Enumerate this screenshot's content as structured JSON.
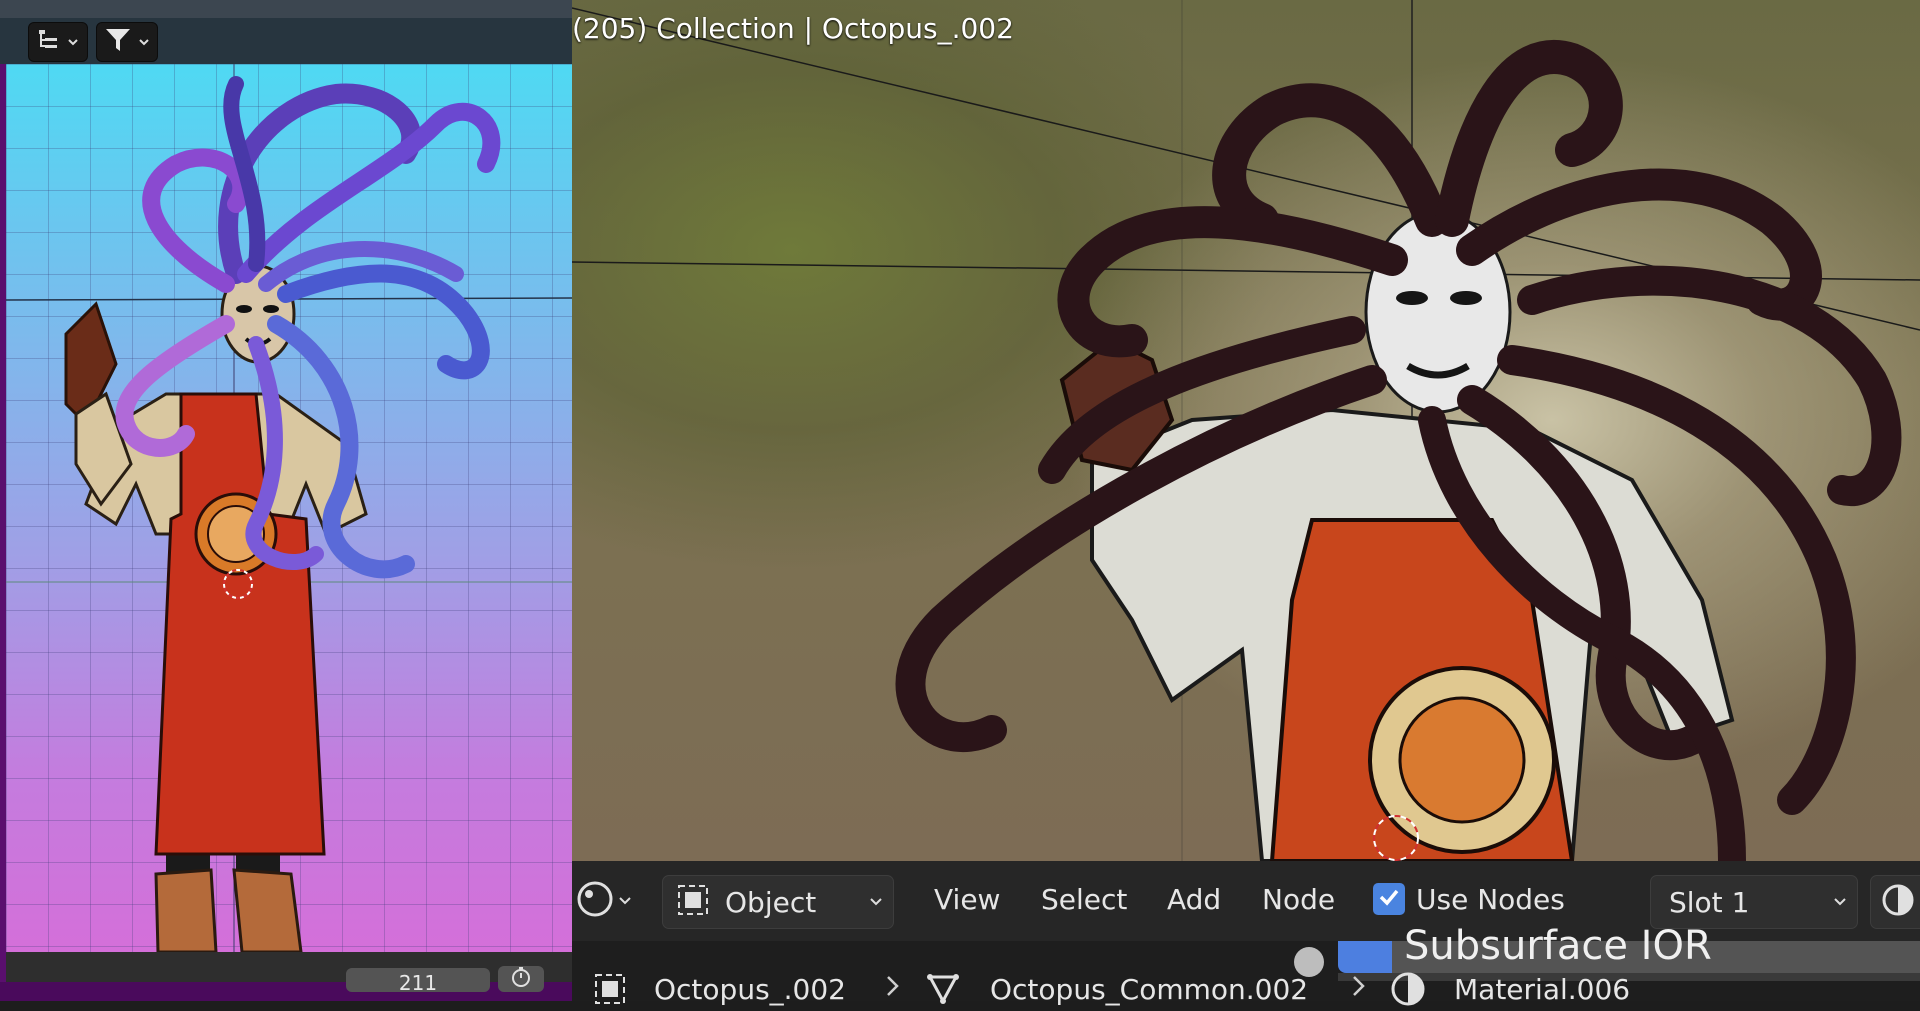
{
  "left_viewport": {
    "frame_value": "211",
    "header": {
      "display_mode_icon": "outliner-tree-icon",
      "filter_icon": "funnel-filter-icon"
    }
  },
  "right_viewport": {
    "title": "(205) Collection | Octopus_.002"
  },
  "editor_header": {
    "editor_type_icon": "node-editor-icon",
    "mode_label": "Object",
    "menus": [
      "View",
      "Select",
      "Add",
      "Node"
    ],
    "use_nodes_label": "Use Nodes",
    "use_nodes_checked": true,
    "slot_label": "Slot 1"
  },
  "node_field": {
    "label": "Subsurface IOR"
  },
  "breadcrumb": {
    "object": "Octopus_.002",
    "mesh": "Octopus_Common.002",
    "material": "Material.006"
  },
  "colors": {
    "accent_blue": "#4a84e0",
    "header_bg": "#262626",
    "left_gradient_top": "#4fd9f3",
    "left_gradient_bottom": "#d46fd9"
  }
}
